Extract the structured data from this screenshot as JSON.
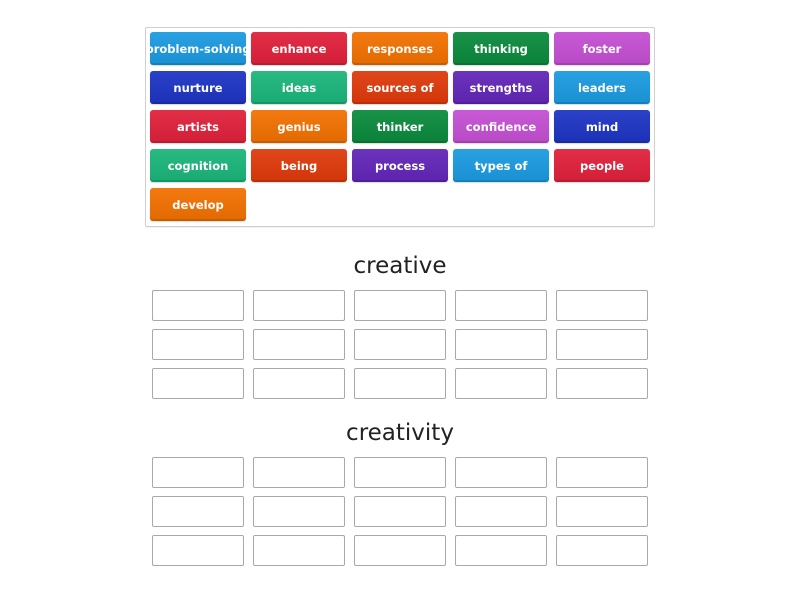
{
  "tile_bank": {
    "tiles": [
      {
        "label": "problem-solving",
        "color": "#1a9ae0"
      },
      {
        "label": "enhance",
        "color": "#e0213b"
      },
      {
        "label": "responses",
        "color": "#f27100"
      },
      {
        "label": "thinking",
        "color": "#0b8a3c"
      },
      {
        "label": "foster",
        "color": "#c44fd2"
      },
      {
        "label": "nurture",
        "color": "#1d34c4"
      },
      {
        "label": "ideas",
        "color": "#1bb57a"
      },
      {
        "label": "sources of",
        "color": "#de3a0a"
      },
      {
        "label": "strengths",
        "color": "#6226b8"
      },
      {
        "label": "leaders",
        "color": "#1a9ae0"
      },
      {
        "label": "artists",
        "color": "#e0213b"
      },
      {
        "label": "genius",
        "color": "#f27100"
      },
      {
        "label": "thinker",
        "color": "#0b8a3c"
      },
      {
        "label": "confidence",
        "color": "#c44fd2"
      },
      {
        "label": "mind",
        "color": "#1d34c4"
      },
      {
        "label": "cognition",
        "color": "#1bb57a"
      },
      {
        "label": "being",
        "color": "#de3a0a"
      },
      {
        "label": "process",
        "color": "#6226b8"
      },
      {
        "label": "types of",
        "color": "#1a9ae0"
      },
      {
        "label": "people",
        "color": "#e0213b"
      },
      {
        "label": "develop",
        "color": "#f27100"
      }
    ]
  },
  "groups": [
    {
      "title": "creative",
      "slots": 15
    },
    {
      "title": "creativity",
      "slots": 15
    }
  ]
}
